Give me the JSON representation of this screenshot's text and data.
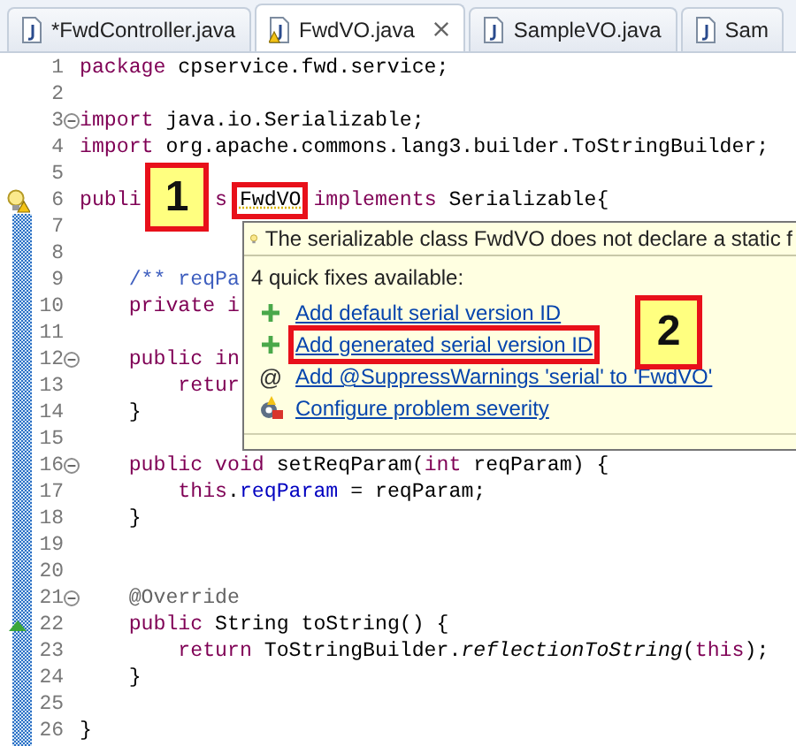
{
  "tabs": [
    {
      "label": "*FwdController.java",
      "selected": false
    },
    {
      "label": "FwdVO.java",
      "selected": true,
      "warning": true,
      "closable": true
    },
    {
      "label": "SampleVO.java",
      "selected": false
    },
    {
      "label": "Sam",
      "selected": false
    }
  ],
  "editor": {
    "lines": [
      {
        "n": "1",
        "tokens": [
          {
            "t": "package",
            "kind": "keyword"
          },
          {
            "t": " cpservice.fwd.service;",
            "kind": "plain"
          }
        ]
      },
      {
        "n": "2"
      },
      {
        "n": "3",
        "fold": true,
        "tokens": [
          {
            "t": "import",
            "kind": "keyword"
          },
          {
            "t": " java.io.Serializable;",
            "kind": "plain"
          }
        ]
      },
      {
        "n": "4",
        "tokens": [
          {
            "t": "import",
            "kind": "keyword"
          },
          {
            "t": " org.apache.commons.lang3.builder.ToStringBuilder;",
            "kind": "plain"
          }
        ]
      },
      {
        "n": "5"
      },
      {
        "n": "6",
        "marker": {
          "kind": "warning"
        },
        "tokens": [
          {
            "t": "publi",
            "kind": "keyword"
          },
          {
            "t": "s ",
            "kind": "keyword_after_callout"
          },
          {
            "t": "FwdVO",
            "kind": "warning",
            "highlighted": true
          },
          {
            "t": " implements",
            "kind": "keyword"
          },
          {
            "t": " Serializable{",
            "kind": "plain"
          }
        ]
      },
      {
        "n": "7"
      },
      {
        "n": "8"
      },
      {
        "n": "9",
        "tokens": [
          {
            "t": "    /** reqPa",
            "kind": "comment"
          }
        ]
      },
      {
        "n": "10",
        "tokens": [
          {
            "t": "    private i",
            "kind": "keyword"
          }
        ]
      },
      {
        "n": "11"
      },
      {
        "n": "12",
        "fold": true,
        "tokens": [
          {
            "t": "    public in",
            "kind": "keyword"
          }
        ]
      },
      {
        "n": "13",
        "tokens": [
          {
            "t": "        retur",
            "kind": "keyword"
          }
        ]
      },
      {
        "n": "14",
        "tokens": [
          {
            "t": "    }",
            "kind": "plain"
          }
        ]
      },
      {
        "n": "15"
      },
      {
        "n": "16",
        "fold": true,
        "tokens": [
          {
            "t": "    public void",
            "kind": "keyword"
          },
          {
            "t": " setReqParam(",
            "kind": "plain"
          },
          {
            "t": "int",
            "kind": "keyword"
          },
          {
            "t": " reqParam) {",
            "kind": "plain"
          }
        ]
      },
      {
        "n": "17",
        "tokens": [
          {
            "t": "        this",
            "kind": "keyword"
          },
          {
            "t": ".",
            "kind": "plain"
          },
          {
            "t": "reqParam",
            "kind": "field"
          },
          {
            "t": " = reqParam;",
            "kind": "plain"
          }
        ]
      },
      {
        "n": "18",
        "tokens": [
          {
            "t": "    }",
            "kind": "plain"
          }
        ]
      },
      {
        "n": "19"
      },
      {
        "n": "20"
      },
      {
        "n": "21",
        "fold": true,
        "tokens": [
          {
            "t": "    @Override",
            "kind": "annotation"
          }
        ]
      },
      {
        "n": "22",
        "marker": {
          "kind": "override"
        },
        "tokens": [
          {
            "t": "    public",
            "kind": "keyword"
          },
          {
            "t": " String toString() {",
            "kind": "plain"
          }
        ]
      },
      {
        "n": "23",
        "tokens": [
          {
            "t": "        return",
            "kind": "keyword"
          },
          {
            "t": " ToStringBuilder.",
            "kind": "plain"
          },
          {
            "t": "reflectionToString",
            "kind": "static_call"
          },
          {
            "t": "(",
            "kind": "plain"
          },
          {
            "t": "this",
            "kind": "keyword"
          },
          {
            "t": ");",
            "kind": "plain"
          }
        ]
      },
      {
        "n": "24",
        "tokens": [
          {
            "t": "    }",
            "kind": "plain"
          }
        ]
      },
      {
        "n": "25"
      },
      {
        "n": "26",
        "tokens": [
          {
            "t": "}",
            "kind": "plain"
          }
        ]
      }
    ]
  },
  "quick_fix": {
    "problem": "The serializable class FwdVO does not declare a static f",
    "heading": "4 quick fixes available:",
    "fixes": [
      {
        "kind": "add",
        "label": "Add default serial version ID",
        "highlighted": false
      },
      {
        "kind": "add",
        "label": "Add generated serial version ID",
        "highlighted": true
      },
      {
        "kind": "annotation",
        "symbol": "@",
        "label": "Add @SuppressWarnings 'serial' to 'FwdVO'",
        "highlighted": false
      },
      {
        "kind": "configure",
        "label": "Configure problem severity",
        "highlighted": false
      }
    ]
  },
  "callouts": [
    {
      "label": "1"
    },
    {
      "label": "2"
    }
  ]
}
